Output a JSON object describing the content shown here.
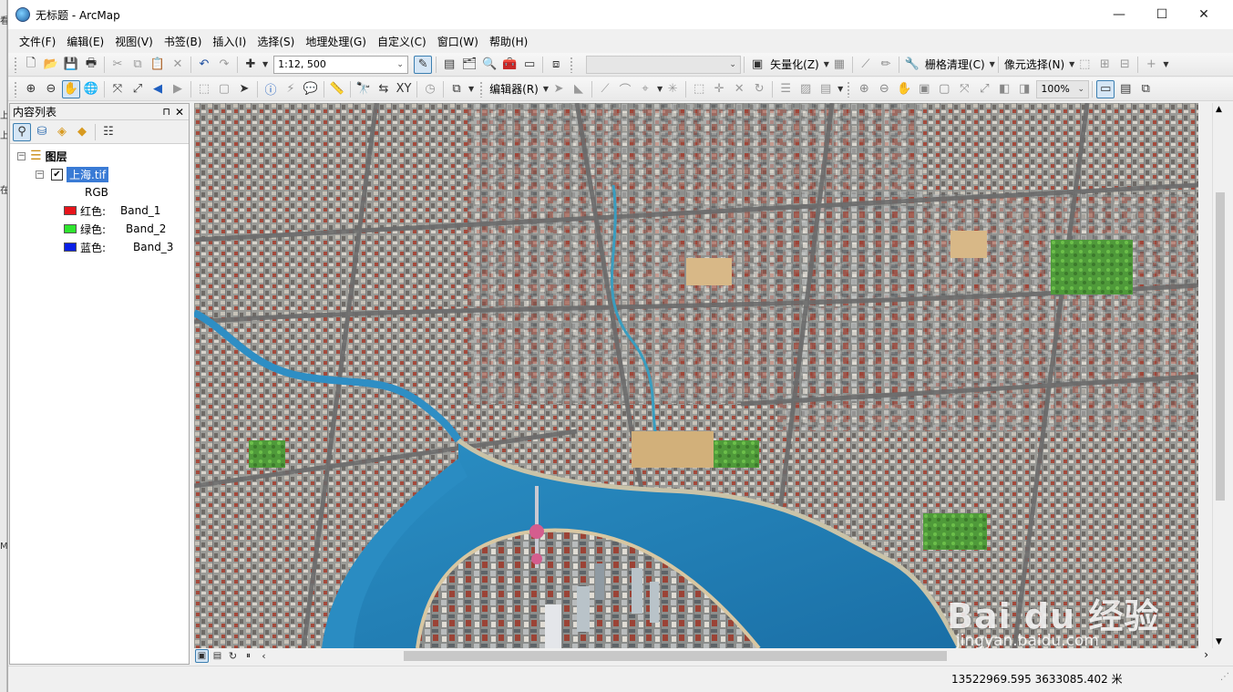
{
  "window": {
    "title": "无标题 - ArcMap",
    "controls": {
      "minimize": "—",
      "maximize": "☐",
      "close": "✕"
    }
  },
  "menubar": [
    "文件(F)",
    "编辑(E)",
    "视图(V)",
    "书签(B)",
    "插入(I)",
    "选择(S)",
    "地理处理(G)",
    "自定义(C)",
    "窗口(W)",
    "帮助(H)"
  ],
  "toolbar": {
    "scale": "1:12, 500",
    "vectorize_label": "矢量化(Z)",
    "raster_cleanup_label": "栅格清理(C)",
    "pixel_select_label": "像元选择(N)",
    "editor_label": "编辑器(R)",
    "zoom_percent": "100%"
  },
  "toc": {
    "title": "内容列表",
    "pin_glyph": "⊓",
    "close_glyph": "✕",
    "layers_root": "图层",
    "layer_name": "上海.tif",
    "layer_checked": true,
    "rgb_label": "RGB",
    "bands": [
      {
        "channel": "红色:",
        "band": "Band_1",
        "color": "#e8141b"
      },
      {
        "channel": "绿色:",
        "band": "Band_2",
        "color": "#2ee52e"
      },
      {
        "channel": "蓝色:",
        "band": "Band_3",
        "color": "#0a1fe6"
      }
    ]
  },
  "status": {
    "coordinates": "13522969.595  3633085.402 米"
  },
  "watermark": {
    "logo_text": "Bai du 经验",
    "url_text": "jingyan.baidu.com"
  },
  "edge_strip": [
    "看",
    "上",
    "上",
    "在",
    "M"
  ]
}
